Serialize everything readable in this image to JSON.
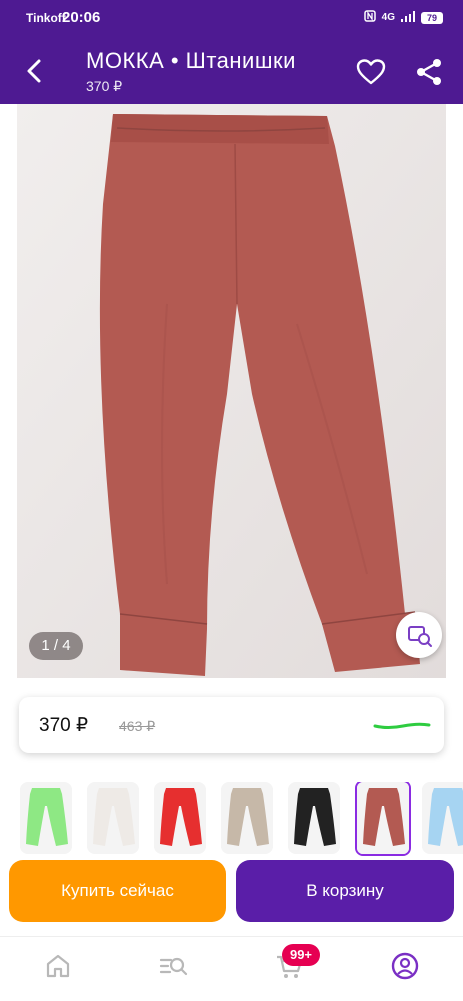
{
  "status_bar": {
    "carrier": "Tinkoff",
    "time": "20:06",
    "network": "4G",
    "battery": "79"
  },
  "header": {
    "title": "МОККА  •  Штанишки",
    "subtitle": "370 ₽"
  },
  "gallery": {
    "counter": "1 / 4"
  },
  "price_block": {
    "price": "370 ₽",
    "old_price": "463 ₽"
  },
  "thumbnails": [
    {
      "color": "#8ee884"
    },
    {
      "color": "#eeeae6"
    },
    {
      "color": "#e62f2f"
    },
    {
      "color": "#c6b8a8"
    },
    {
      "color": "#222222"
    },
    {
      "color": "#b35a52",
      "selected": true
    },
    {
      "color": "#a6d4f2"
    }
  ],
  "buttons": {
    "buy_now": "Купить сейчас",
    "add_to_cart": "В корзину"
  },
  "bottom_nav": {
    "cart_badge": "99+"
  },
  "colors": {
    "brand": "#4e1a92",
    "buy": "#ff9800",
    "cart": "#5a1ea8",
    "badge": "#e60052",
    "pants": "#b35a52"
  }
}
